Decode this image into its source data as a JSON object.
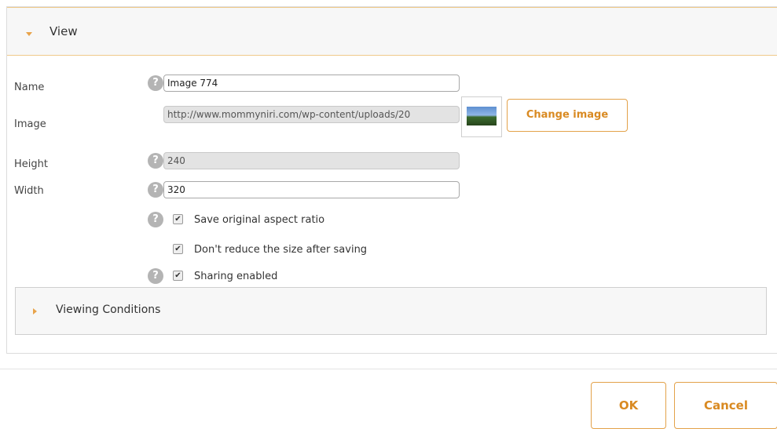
{
  "view_panel": {
    "title": "View"
  },
  "form": {
    "name_label": "Name",
    "name_value": "Image 774",
    "image_label": "Image",
    "image_url": "http://www.mommyniri.com/wp-content/uploads/20",
    "change_image_label": "Change image",
    "height_label": "Height",
    "height_value": "240",
    "width_label": "Width",
    "width_value": "320",
    "help_glyph": "?",
    "options": [
      {
        "label": "Save original aspect ratio",
        "checked": true
      },
      {
        "label": "Don't reduce the size after saving",
        "checked": true
      },
      {
        "label": "Sharing enabled",
        "checked": true
      }
    ]
  },
  "viewing_conditions": {
    "title": "Viewing Conditions"
  },
  "footer": {
    "ok_label": "OK",
    "cancel_label": "Cancel"
  },
  "colors": {
    "accent": "#d98a22",
    "accent_border": "#e3a24a",
    "help_icon": "#b4b4b4"
  },
  "icons": {
    "expanded": "caret-down-icon",
    "collapsed": "caret-right-icon",
    "help": "help-icon",
    "check": "checkmark-icon"
  }
}
